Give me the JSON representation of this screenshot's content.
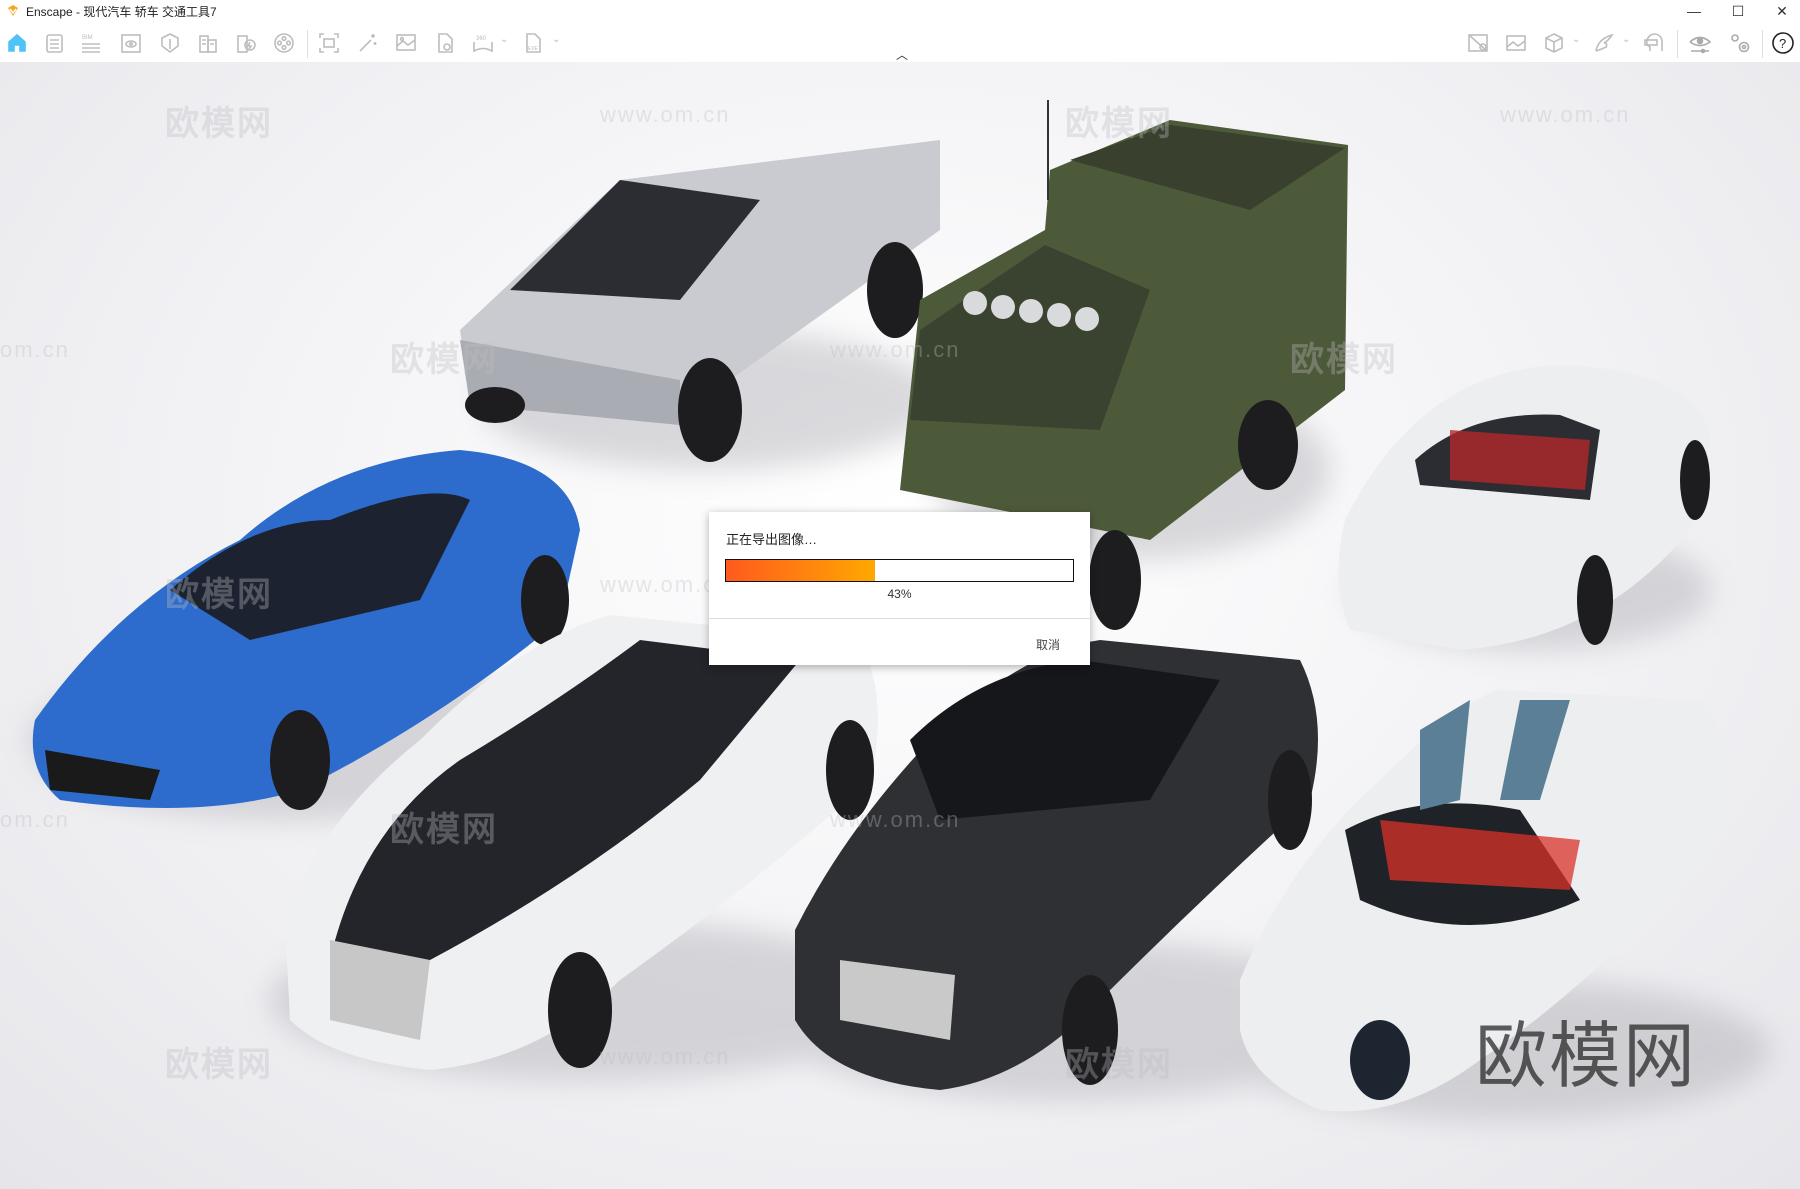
{
  "window": {
    "title": "Enscape - 现代汽车 轿车 交通工具7",
    "minimize": "—",
    "maximize": "☐",
    "close": "✕"
  },
  "toolbar": {
    "left": [
      {
        "name": "home-icon"
      },
      {
        "name": "notes-icon"
      },
      {
        "name": "bim-icon",
        "label": "BIM"
      },
      {
        "name": "view-icon"
      },
      {
        "name": "material-icon"
      },
      {
        "name": "building-icon"
      },
      {
        "name": "building-energy-icon"
      },
      {
        "name": "video-reel-icon"
      },
      {
        "name": "screenshot-icon"
      },
      {
        "name": "magic-wand-icon"
      },
      {
        "name": "image-icon"
      },
      {
        "name": "export-file-icon"
      },
      {
        "name": "panorama-360-icon",
        "label": "360"
      },
      {
        "name": "exe-export-icon",
        "label": "EXE"
      }
    ],
    "right": [
      {
        "name": "site-map-icon"
      },
      {
        "name": "image-settings-icon"
      },
      {
        "name": "asset-cube-icon"
      },
      {
        "name": "wings-icon"
      },
      {
        "name": "vr-headset-icon"
      },
      {
        "name": "visual-settings-icon"
      },
      {
        "name": "settings-icon"
      },
      {
        "name": "help-icon",
        "label": "?"
      }
    ],
    "accent": "#4fc3f7"
  },
  "dialog": {
    "message": "正在导出图像…",
    "progress": 43,
    "progress_label": "43%",
    "cancel": "取消"
  },
  "watermarks": {
    "logo": "欧模网",
    "url": "www.om.cn",
    "partial": "om.cn"
  }
}
